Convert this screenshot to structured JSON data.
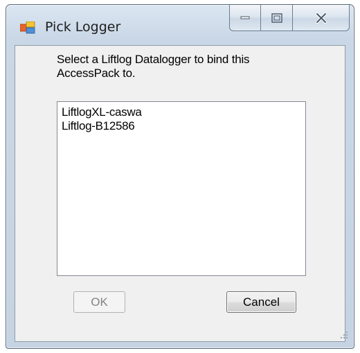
{
  "window": {
    "title": "Pick Logger",
    "icon": "application-window-icon",
    "caption_buttons": [
      "minimize-icon",
      "maximize-icon",
      "close-icon"
    ]
  },
  "prompt": {
    "text": "Select a Liftlog Datalogger to bind this AccessPack to."
  },
  "logger_list": {
    "items": [
      {
        "label": "LiftlogXL-caswa"
      },
      {
        "label": "Liftlog-B12586"
      }
    ]
  },
  "buttons": {
    "ok_label": "OK",
    "ok_enabled": false,
    "cancel_label": "Cancel"
  },
  "colors": {
    "title_text": "#1e1e1e",
    "client_background": "#f0f0f0",
    "disabled_text": "#838383"
  }
}
